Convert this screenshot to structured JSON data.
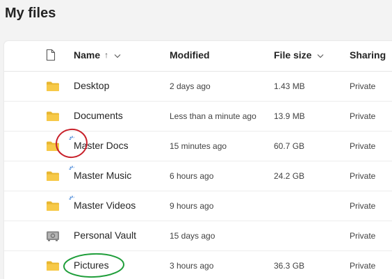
{
  "page_title": "My files",
  "header": {
    "name": "Name",
    "sort_arrow": "↑",
    "modified": "Modified",
    "file_size": "File size",
    "sharing": "Sharing"
  },
  "colors": {
    "folder": "#f7c948",
    "folder_dark": "#e8b730",
    "vault": "#8a8a8a",
    "sync_blue": "#1f6fd1",
    "annot_red": "#c8202a",
    "annot_green": "#1f9e3a"
  },
  "rows": [
    {
      "name": "Desktop",
      "modified": "2 days ago",
      "size": "1.43 MB",
      "sharing": "Private",
      "icon": "folder-icon",
      "syncing": false
    },
    {
      "name": "Documents",
      "modified": "Less than a minute ago",
      "size": "13.9 MB",
      "sharing": "Private",
      "icon": "folder-icon",
      "syncing": false
    },
    {
      "name": "Master Docs",
      "modified": "15 minutes ago",
      "size": "60.7 GB",
      "sharing": "Private",
      "icon": "folder-icon",
      "syncing": true
    },
    {
      "name": "Master Music",
      "modified": "6 hours ago",
      "size": "24.2 GB",
      "sharing": "Private",
      "icon": "folder-icon",
      "syncing": true
    },
    {
      "name": "Master Videos",
      "modified": "9 hours ago",
      "size": "",
      "sharing": "Private",
      "icon": "folder-icon",
      "syncing": true
    },
    {
      "name": "Personal Vault",
      "modified": "15 days ago",
      "size": "",
      "sharing": "Private",
      "icon": "vault-icon",
      "syncing": false
    },
    {
      "name": "Pictures",
      "modified": "3 hours ago",
      "size": "36.3 GB",
      "sharing": "Private",
      "icon": "folder-icon",
      "syncing": false
    }
  ]
}
